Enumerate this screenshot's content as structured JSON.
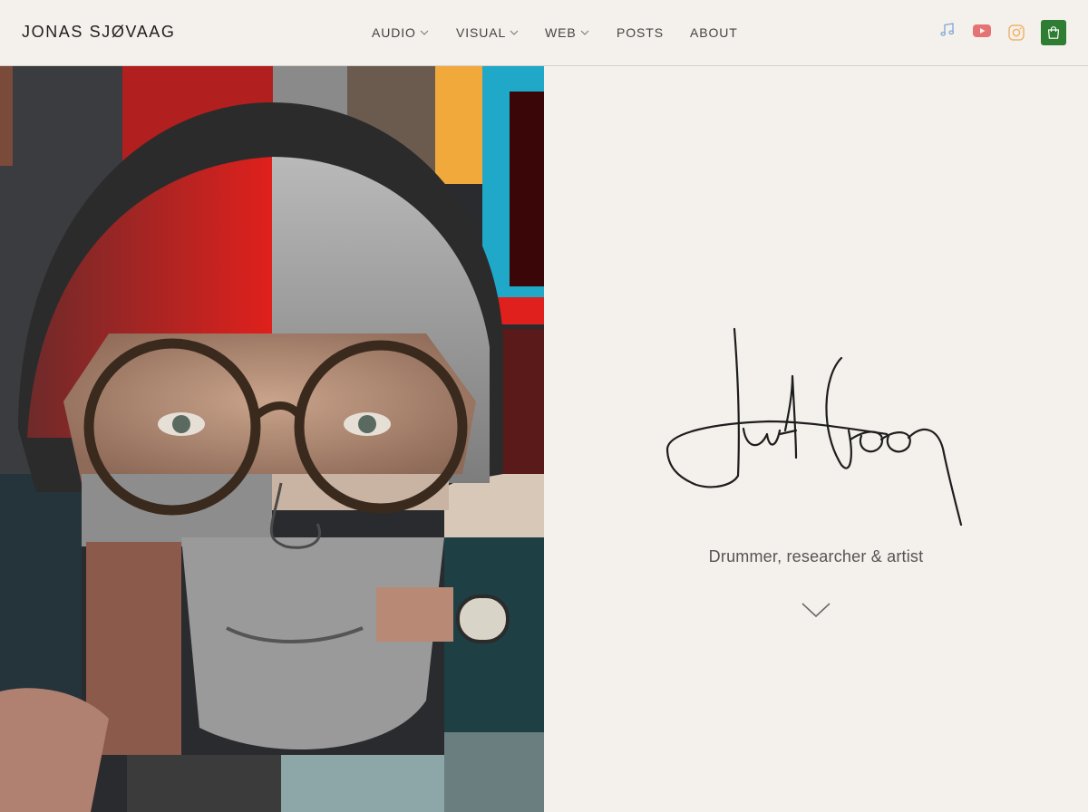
{
  "site": {
    "brand": "JONAS SJØVAAG"
  },
  "nav": {
    "items": [
      {
        "label": "AUDIO",
        "has_dropdown": true
      },
      {
        "label": "VISUAL",
        "has_dropdown": true
      },
      {
        "label": "WEB",
        "has_dropdown": true
      },
      {
        "label": "POSTS",
        "has_dropdown": false
      },
      {
        "label": "ABOUT",
        "has_dropdown": false
      }
    ]
  },
  "social": {
    "icons": [
      {
        "name": "music-note-icon",
        "color": "#7fa6d6"
      },
      {
        "name": "youtube-icon",
        "color": "#e57373"
      },
      {
        "name": "instagram-icon",
        "color": "#f0b36b"
      }
    ],
    "cart": {
      "name": "shopping-bag-icon",
      "color": "#2e7d32"
    }
  },
  "hero": {
    "tagline": "Drummer, researcher & artist",
    "scroll_icon": "chevron-down-icon"
  },
  "colors": {
    "background": "#f4f0ec",
    "accent_red": "#e0201c",
    "accent_blue": "#20a8c8",
    "accent_orange": "#f2a93b"
  }
}
